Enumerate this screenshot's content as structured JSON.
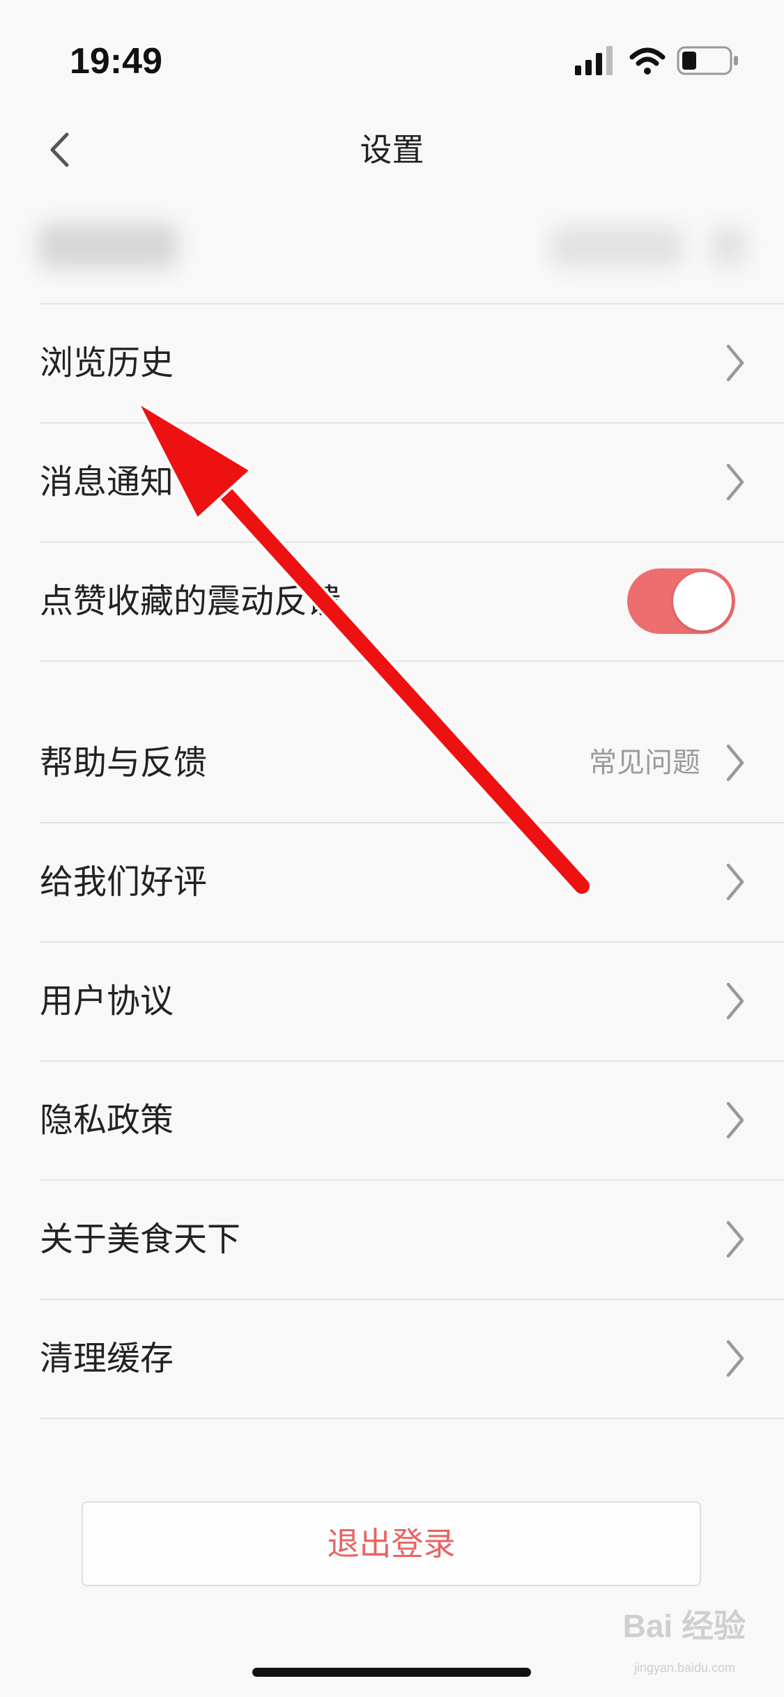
{
  "status_bar": {
    "time": "19:49",
    "icons": [
      "signal-icon",
      "wifi-icon",
      "battery-icon"
    ]
  },
  "nav": {
    "title": "设置",
    "back_icon": "chevron-left-icon"
  },
  "settings": {
    "browse_history": "浏览历史",
    "notifications": "消息通知",
    "vibration_feedback": "点赞收藏的震动反馈",
    "vibration_enabled": true,
    "help_feedback": "帮助与反馈",
    "help_hint": "常见问题",
    "rate_us": "给我们好评",
    "user_agreement": "用户协议",
    "privacy_policy": "隐私政策",
    "about": "关于美食天下",
    "clear_cache": "清理缓存"
  },
  "logout": {
    "label": "退出登录"
  },
  "watermark": {
    "brand": "Bai 经验",
    "domain": "jingyan.baidu.com"
  },
  "colors": {
    "accent": "#e86464",
    "toggle_on": "#ec6e6e",
    "background": "#f8f8f8",
    "divider": "#e3e3e3",
    "annotation_arrow": "#ee1111"
  }
}
